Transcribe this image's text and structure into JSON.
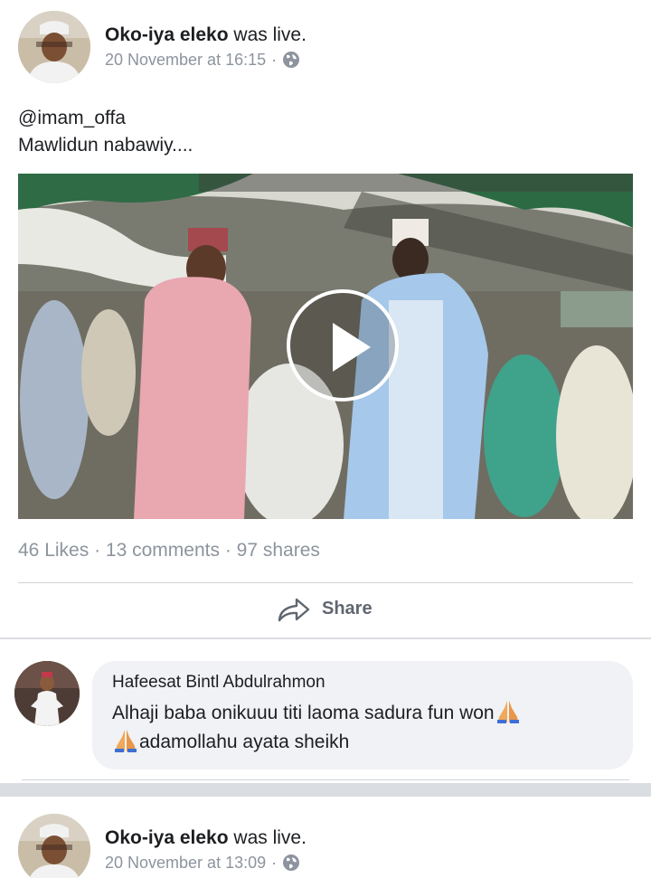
{
  "posts": [
    {
      "author": "Oko-iya eleko",
      "action": "was live.",
      "timestamp": "20 November at 16:15",
      "separator": "·",
      "privacy_icon": "globe-icon",
      "text_lines": [
        "@imam_offa",
        "Mawlidun nabawiy...."
      ],
      "video": {
        "play_icon": "play-icon"
      },
      "stats": {
        "likes": "46 Likes",
        "comments": "13 comments",
        "shares": "97 shares",
        "separator": "·"
      },
      "share_label": "Share",
      "comment": {
        "author": "Hafeesat Bintl Abdulrahmon",
        "text_line1": "Alhaji baba onikuuu titi laoma sadura fun won",
        "text_line2": "adamollahu ayata sheikh",
        "emoji_icon": "folded-hands-icon"
      }
    },
    {
      "author": "Oko-iya eleko",
      "action": "was live.",
      "timestamp": "20 November at 13:09",
      "separator": "·",
      "privacy_icon": "globe-icon"
    }
  ],
  "colors": {
    "text_primary": "#1c1e21",
    "text_secondary": "#8d949e",
    "bubble_bg": "#f0f2f5",
    "divider": "#dadde1"
  }
}
